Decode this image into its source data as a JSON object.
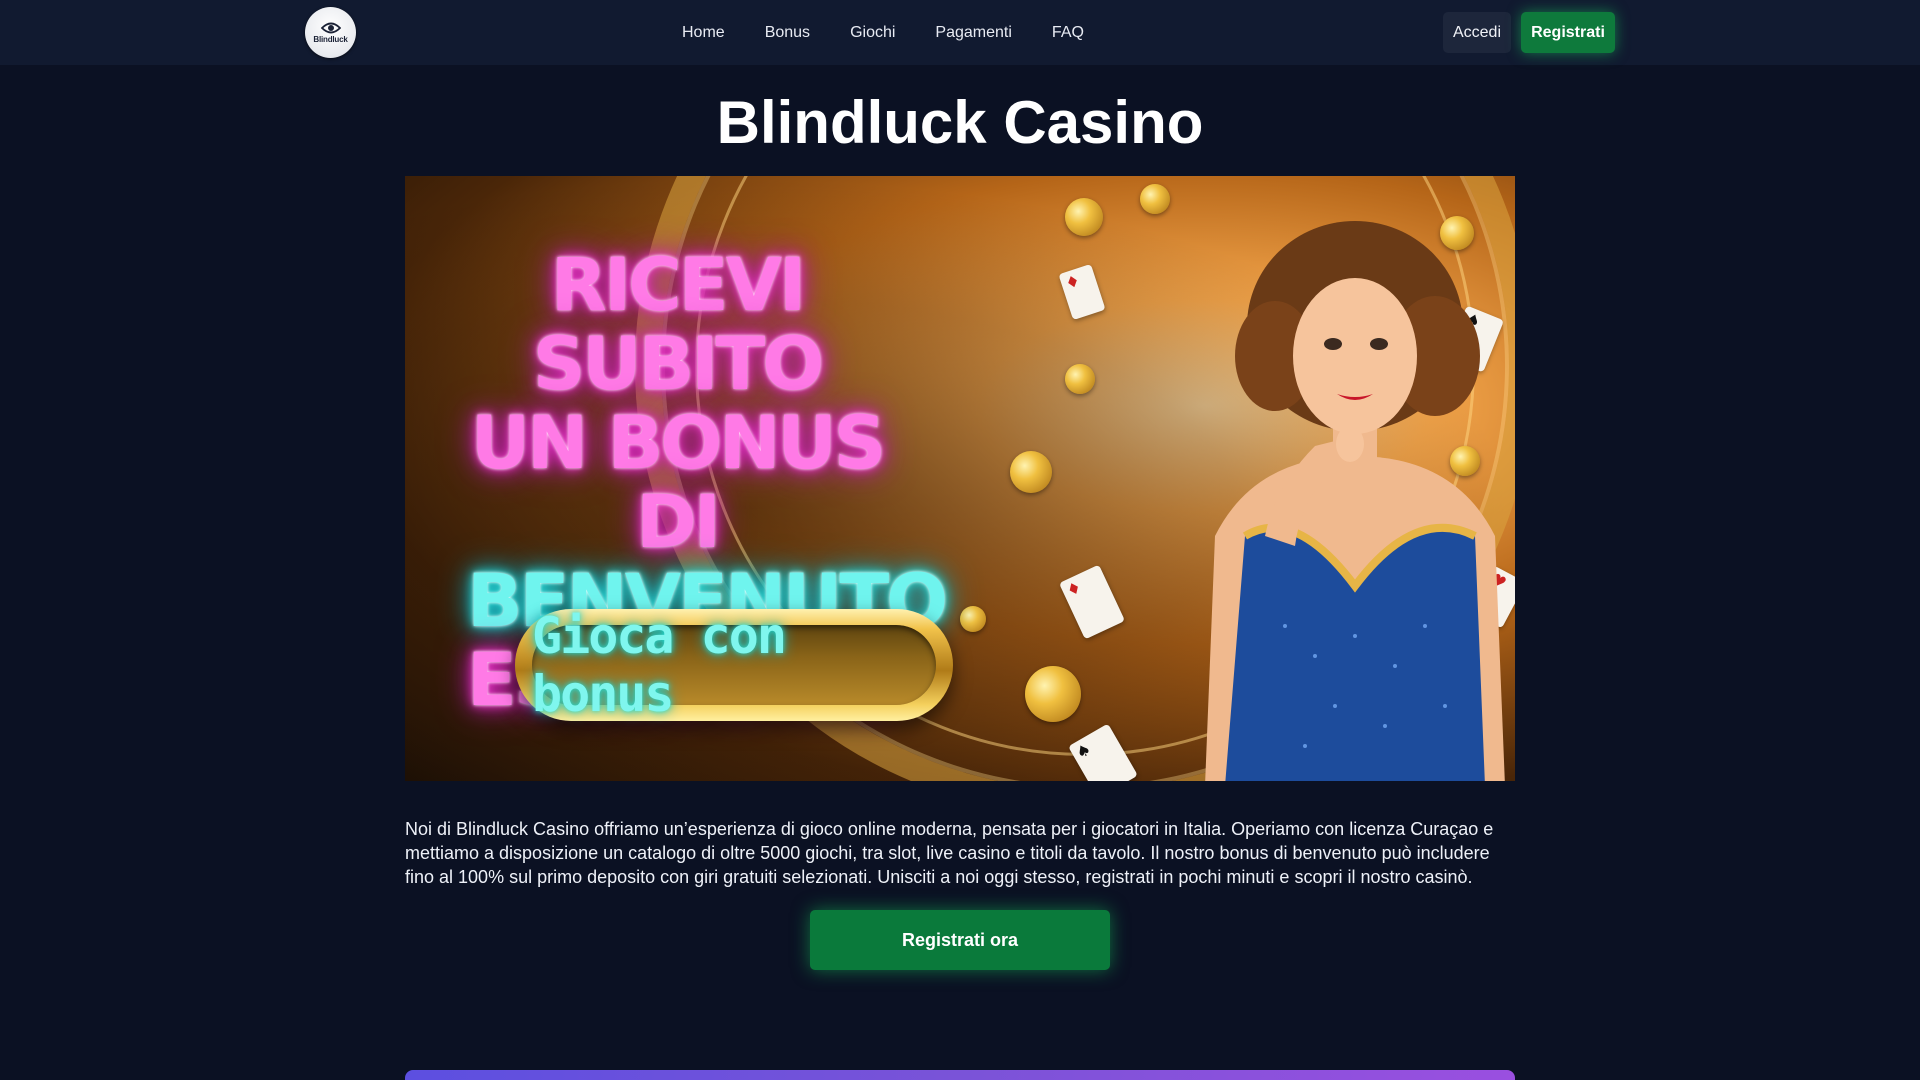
{
  "header": {
    "logo_text": "Blindluck",
    "nav": [
      "Home",
      "Bonus",
      "Giochi",
      "Pagamenti",
      "FAQ"
    ],
    "login_label": "Accedi",
    "register_label": "Registrati"
  },
  "page_title": "Blindluck Casino",
  "banner": {
    "line1": "RICEVI SUBITO",
    "line2": "UN BONUS DI",
    "line3": "BENVENUTO",
    "line4": "ESCLUSIVO",
    "cta": "Gioca con bonus"
  },
  "description": "Noi di Blindluck Casino offriamo un’esperienza di gioco online moderna, pensata per i giocatori in Italia. Operiamo con licenza Curaçao e mettiamo a disposizione un catalogo di oltre 5000 giochi, tra slot, live casino e titoli da tavolo. Il nostro bonus di benvenuto può includere fino al 100% sul primo deposito con giri gratuiti selezionati. Unisciti a noi oggi stesso, registrati in pochi minuti e scopri il nostro casinò.",
  "main_cta": "Registrati ora",
  "colors": {
    "background": "#0b1123",
    "header": "#111a30",
    "accent_green": "#0e7a3c"
  }
}
